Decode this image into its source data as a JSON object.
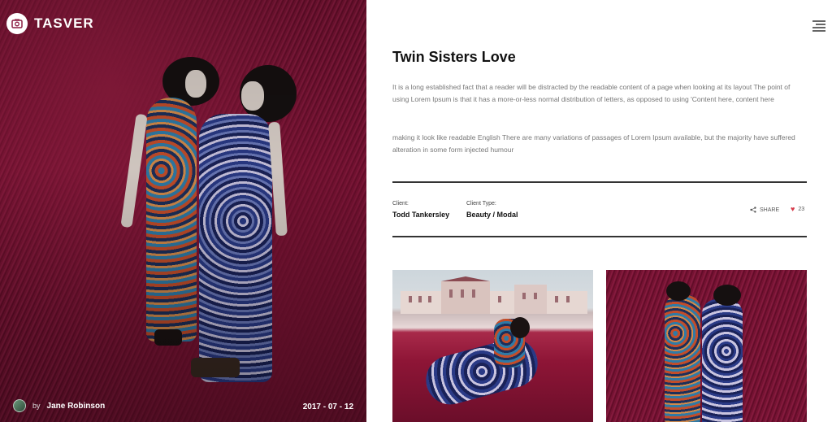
{
  "brand": {
    "name": "TASVER",
    "logo_icon": "camera-icon"
  },
  "hero": {
    "author_by": "by",
    "author_name": "Jane Robinson",
    "date": "2017 - 07 - 12"
  },
  "post": {
    "title": "Twin Sisters Love",
    "paragraph1": "It is a long established fact that a reader will be distracted by the readable content of a page when looking at its layout The point of using Lorem Ipsum is that it has a more-or-less normal distribution of letters, as opposed to using 'Content here, content here",
    "paragraph2": "making it look like readable English There are many variations of passages of Lorem Ipsum available, but the majority have suffered alteration in some form injected humour"
  },
  "meta": {
    "client_label": "Client:",
    "client_value": "Todd Tankersley",
    "type_label": "Client Type:",
    "type_value": "Beauty / Modal",
    "share_label": "SHARE",
    "like_count": "23"
  },
  "colors": {
    "accent": "#d63a4a",
    "hero_bg": "#701230",
    "rule": "#333333"
  }
}
